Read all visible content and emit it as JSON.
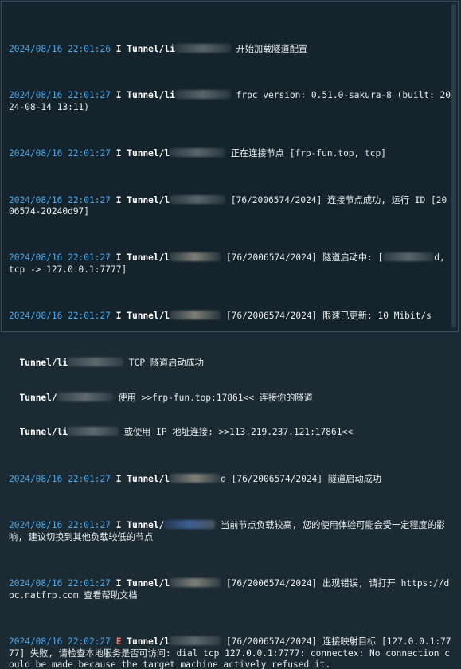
{
  "lines": [
    {
      "ts": "2024/08/16 22:01:26",
      "lvl": "I",
      "tun": "Tunnel/li",
      "msg": " 开始加载隧道配置"
    },
    {
      "ts": "2024/08/16 22:01:27",
      "lvl": "I",
      "tun": "Tunnel/li",
      "msg": " frpc version: 0.51.0-sakura-8 (built: 2024-08-14 13:11)"
    },
    {
      "ts": "2024/08/16 22:01:27",
      "lvl": "I",
      "tun": "Tunnel/l",
      "msg": " 正在连接节点 [frp-fun.top, tcp]"
    },
    {
      "ts": "2024/08/16 22:01:27",
      "lvl": "I",
      "tun": "Tunnel/l",
      "msg": " [76/2006574/2024] 连接节点成功, 运行 ID [2006574-20240d97]"
    },
    {
      "ts": "2024/08/16 22:01:27",
      "lvl": "I",
      "tun": "Tunnel/l",
      "msg": " [76/2006574/2024] 隧道启动中: [",
      "tail": "d, tcp -> 127.0.0.1:7777]"
    },
    {
      "ts": "2024/08/16 22:01:27",
      "lvl": "I",
      "tun": "Tunnel/l",
      "msg": " [76/2006574/2024] 限速已更新: 10 Mibit/s"
    }
  ],
  "info": {
    "l1_prefix": "  Tunnel/li",
    "l1_msg": " TCP 隧道启动成功",
    "l2_prefix": "  Tunnel/",
    "l2_msg": " 使用 >>frp-fun.top:17861<< 连接你的隧道",
    "l3_prefix": "  Tunnel/li",
    "l3_msg": " 或使用 IP 地址连接: >>113.219.237.121:17861<<"
  },
  "lines2": [
    {
      "ts": "2024/08/16 22:01:27",
      "lvl": "I",
      "tun": "Tunnel/l",
      "msg": "o [76/2006574/2024] 隧道启动成功"
    },
    {
      "ts": "2024/08/16 22:01:27",
      "lvl": "I",
      "tun": "Tunnel/",
      "msg": " 当前节点负载较高, 您的使用体验可能会受一定程度的影响, 建议切换到其他负载较低的节点"
    },
    {
      "ts": "2024/08/16 22:01:27",
      "lvl": "I",
      "tun": "Tunnel/l",
      "msg": " [76/2006574/2024] 出现错误, 请打开 https://doc.natfrp.com 查看帮助文档"
    },
    {
      "ts": "2024/08/16 22:02:27",
      "lvl": "E",
      "tun": "Tunnel/l",
      "msg": " [76/2006574/2024] 连接映射目标 [127.0.0.1:7777] 失败, 请检查本地服务是否可访问: dial tcp 127.0.0.1:7777: connectex: No connection could be made because the target machine actively refused it."
    }
  ]
}
